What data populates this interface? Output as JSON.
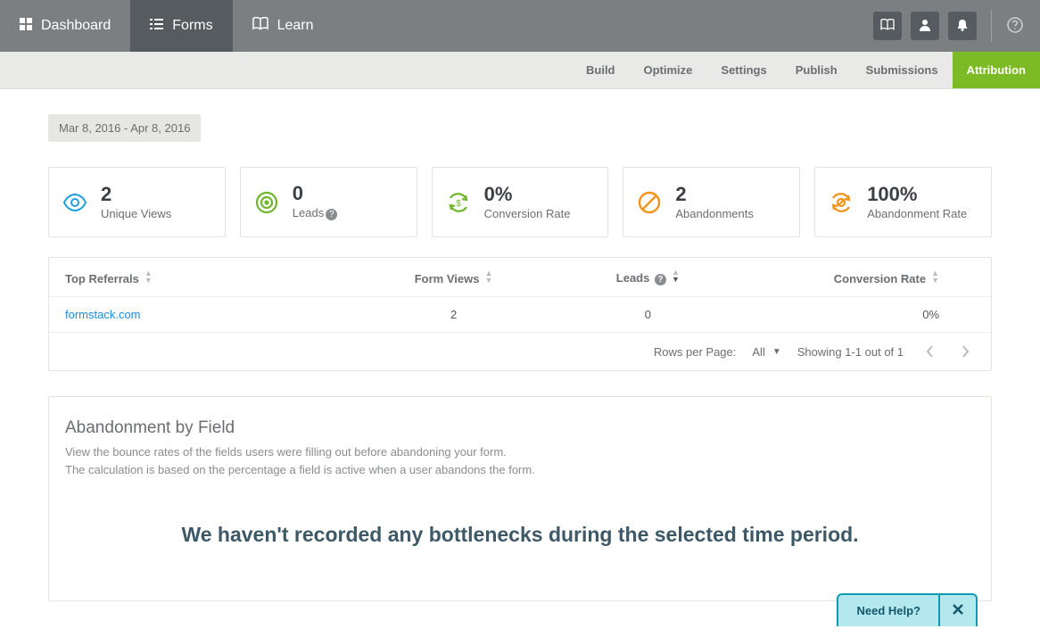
{
  "topnav": {
    "dashboard": "Dashboard",
    "forms": "Forms",
    "learn": "Learn"
  },
  "subnav": {
    "build": "Build",
    "optimize": "Optimize",
    "settings": "Settings",
    "publish": "Publish",
    "submissions": "Submissions",
    "attribution": "Attribution"
  },
  "date_range": "Mar 8, 2016 - Apr 8, 2016",
  "cards": {
    "unique_views": {
      "value": "2",
      "label": "Unique Views"
    },
    "leads": {
      "value": "0",
      "label": "Leads"
    },
    "conversion": {
      "value": "0%",
      "label": "Conversion Rate"
    },
    "abandon": {
      "value": "2",
      "label": "Abandonments"
    },
    "abandon_rate": {
      "value": "100%",
      "label": "Abandonment Rate"
    }
  },
  "table": {
    "h_top": "Top Referrals",
    "h_views": "Form Views",
    "h_leads": "Leads",
    "h_conv": "Conversion Rate",
    "rows": [
      {
        "ref": "formstack.com",
        "views": "2",
        "leads": "0",
        "conv": "0%"
      }
    ],
    "rows_per_page_label": "Rows per Page:",
    "rows_per_page_value": "All",
    "showing": "Showing 1-1 out of 1"
  },
  "aband": {
    "title": "Abandonment by Field",
    "desc1": "View the bounce rates of the fields users were filling out before abandoning your form.",
    "desc2": "The calculation is based on the percentage a field is active when a user abandons the form.",
    "empty": "We haven't recorded any bottlenecks during the selected time period."
  },
  "need_help": "Need Help?"
}
